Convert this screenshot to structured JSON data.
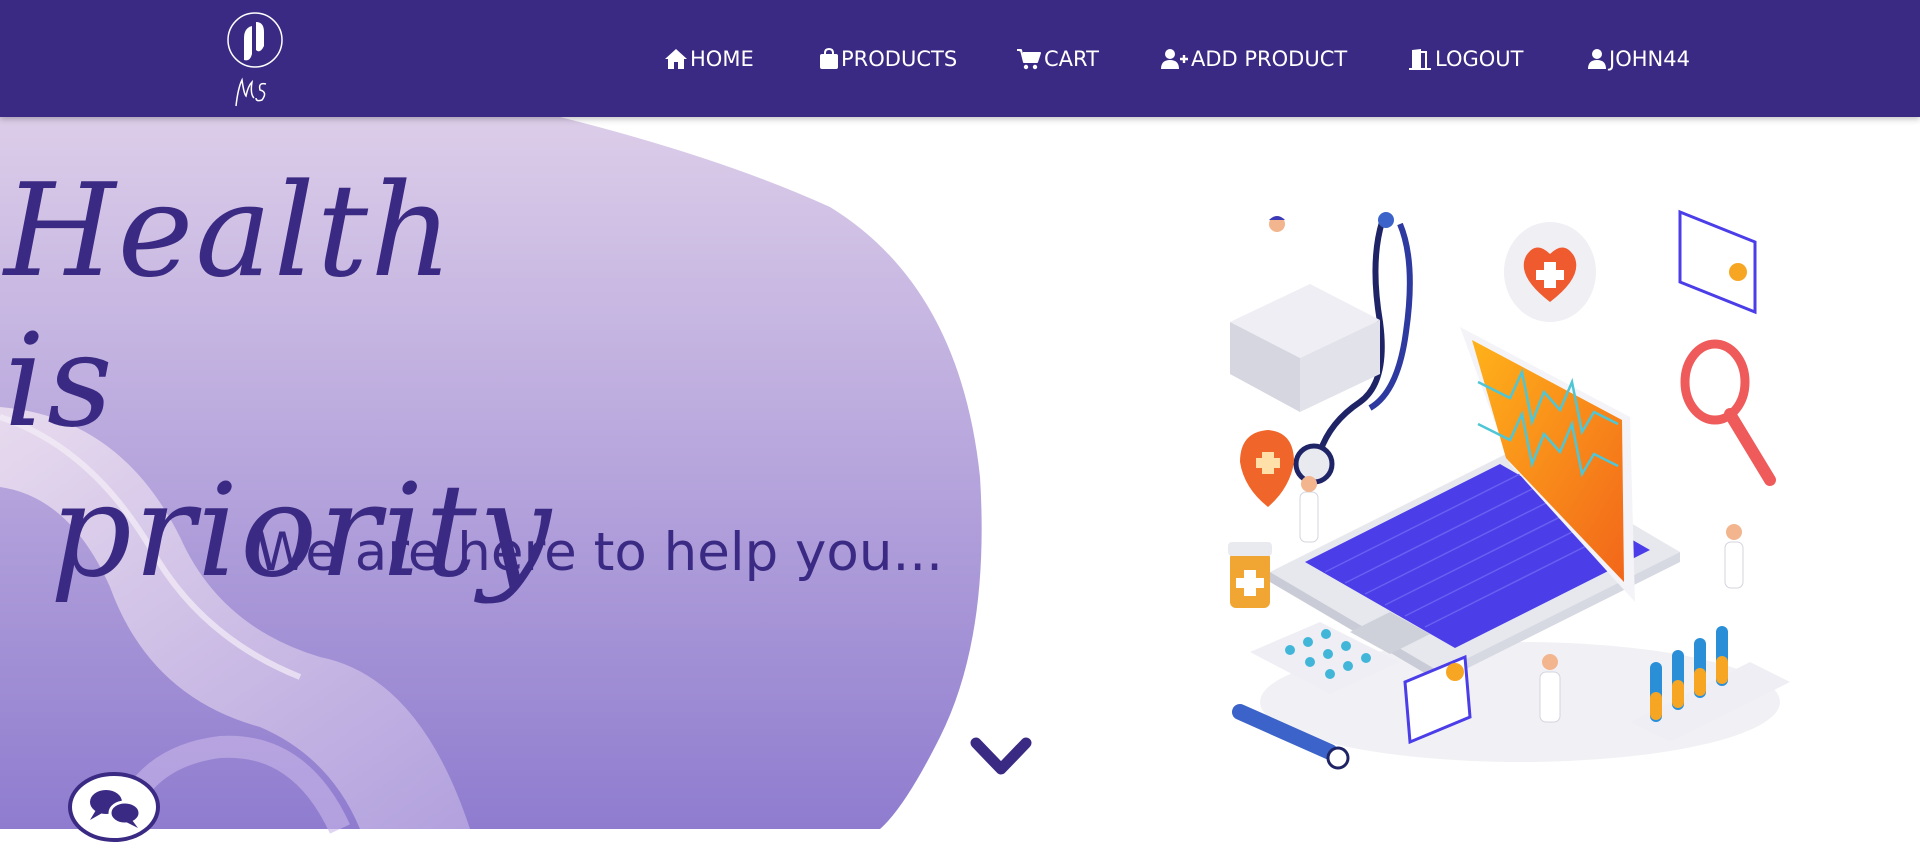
{
  "nav": {
    "items": [
      {
        "icon": "home-icon",
        "label": "HOME"
      },
      {
        "icon": "shopping-bag-icon",
        "label": "PRODUCTS"
      },
      {
        "icon": "cart-icon",
        "label": "CART"
      },
      {
        "icon": "user-plus-icon",
        "label": "ADD PRODUCT"
      },
      {
        "icon": "door-exit-icon",
        "label": "LOGOUT"
      },
      {
        "icon": "user-icon",
        "label": "JOHN44"
      }
    ]
  },
  "hero": {
    "headline_line1": "Health is",
    "headline_line2": "priority",
    "tagline": "We are here to help you..."
  },
  "colors": {
    "brand": "#3b2a83",
    "text_on_brand": "#ffffff",
    "hero_blob_top": "#d9c9e8",
    "hero_blob_bottom": "#8f7ccf"
  },
  "icons": {
    "logo": "ms-logo",
    "scroll": "chevron-down-icon",
    "chat": "chat-bubbles-icon",
    "illustration": "medical-laptop-illustration"
  }
}
